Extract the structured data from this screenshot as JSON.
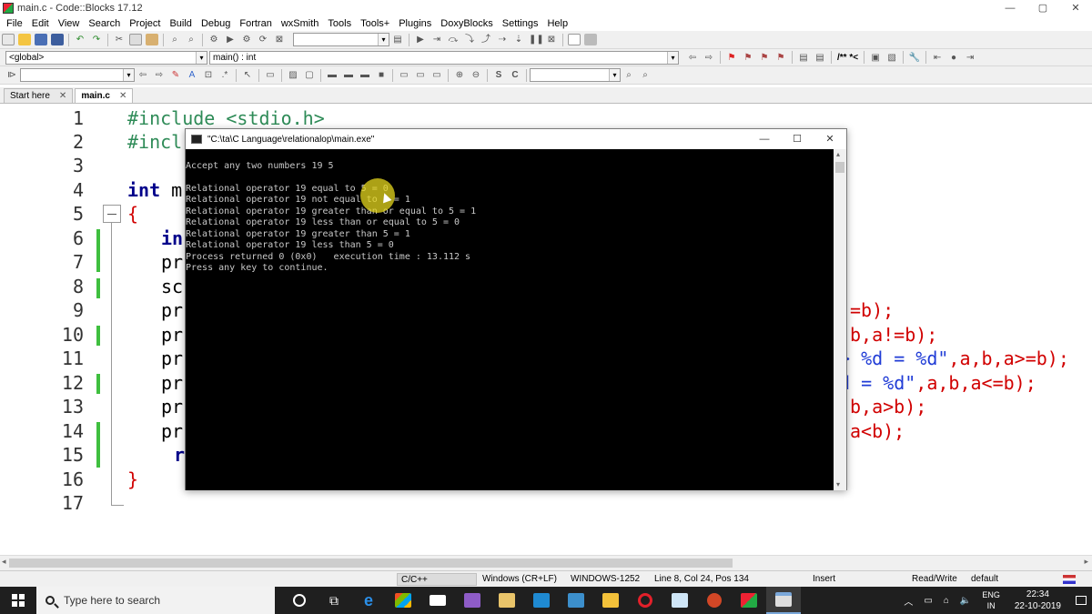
{
  "window": {
    "title": "main.c - Code::Blocks 17.12",
    "controls": [
      "—",
      "▢",
      "✕"
    ]
  },
  "menu": [
    "File",
    "Edit",
    "View",
    "Search",
    "Project",
    "Build",
    "Debug",
    "Fortran",
    "wxSmith",
    "Tools",
    "Tools+",
    "Plugins",
    "DoxyBlocks",
    "Settings",
    "Help"
  ],
  "toolbar2": {
    "scope_value": "<global>",
    "function_value": "main() : int",
    "doxy_comment": "/** *<"
  },
  "tabs": [
    {
      "label": "Start here",
      "close": "✕",
      "active": false
    },
    {
      "label": "main.c",
      "close": "✕",
      "active": true
    }
  ],
  "editor": {
    "line_numbers": [
      "1",
      "2",
      "3",
      "4",
      "5",
      "6",
      "7",
      "8",
      "9",
      "10",
      "11",
      "12",
      "13",
      "14",
      "15",
      "16",
      "17"
    ],
    "code": {
      "l1": "#include <stdio.h>",
      "l2": "#incl",
      "l4_kw": "int",
      "l4_rest": " m",
      "l5": "{",
      "l6": "in",
      "l7": "pr",
      "l8": "sc",
      "l9": "pr",
      "l10": "pr",
      "l11": "pr",
      "l12": "pr",
      "l13": "pr",
      "l14": "pr",
      "l15": "r",
      "l16": "}",
      "r9": "=b);",
      "r10": "b,a!=b);",
      "r11a": "> %d = %d\"",
      "r11b": ",a,b,a>=b);",
      "r12a": "d = %d\"",
      "r12b": ",a,b,a<=b);",
      "r13": "b,a>b);",
      "r14": "a<b);"
    }
  },
  "console": {
    "title": "\"C:\\ta\\C Language\\relationalop\\main.exe\"",
    "controls": [
      "—",
      "☐",
      "✕"
    ],
    "lines": [
      "Accept any two numbers 19 5",
      "",
      "Relational operator 19 equal to 5 = 0",
      "Relational operator 19 not equal to 5 = 1",
      "Relational operator 19 greater than or equal to 5 = 1",
      "Relational operator 19 less than or equal to 5 = 0",
      "Relational operator 19 greater than 5 = 1",
      "Relational operator 19 less than 5 = 0",
      "Process returned 0 (0x0)   execution time : 13.112 s",
      "Press any key to continue."
    ]
  },
  "statusbar": {
    "language": "C/C++",
    "line_endings": "Windows (CR+LF)",
    "encoding": "WINDOWS-1252",
    "position": "Line 8, Col 24, Pos 134",
    "mode": "Insert",
    "access": "Read/Write",
    "profile": "default"
  },
  "taskbar": {
    "search_placeholder": "Type here to search",
    "language_top": "ENG",
    "language_bottom": "IN",
    "time": "22:34",
    "date": "22-10-2019"
  },
  "colors": {
    "keyword": "#00008b",
    "preprocessor": "#2e8b57",
    "operator": "#d10000",
    "string": "#1f3bd6",
    "change_bar": "#3fbf3f",
    "cursor_highlight": "#e6d71e"
  }
}
